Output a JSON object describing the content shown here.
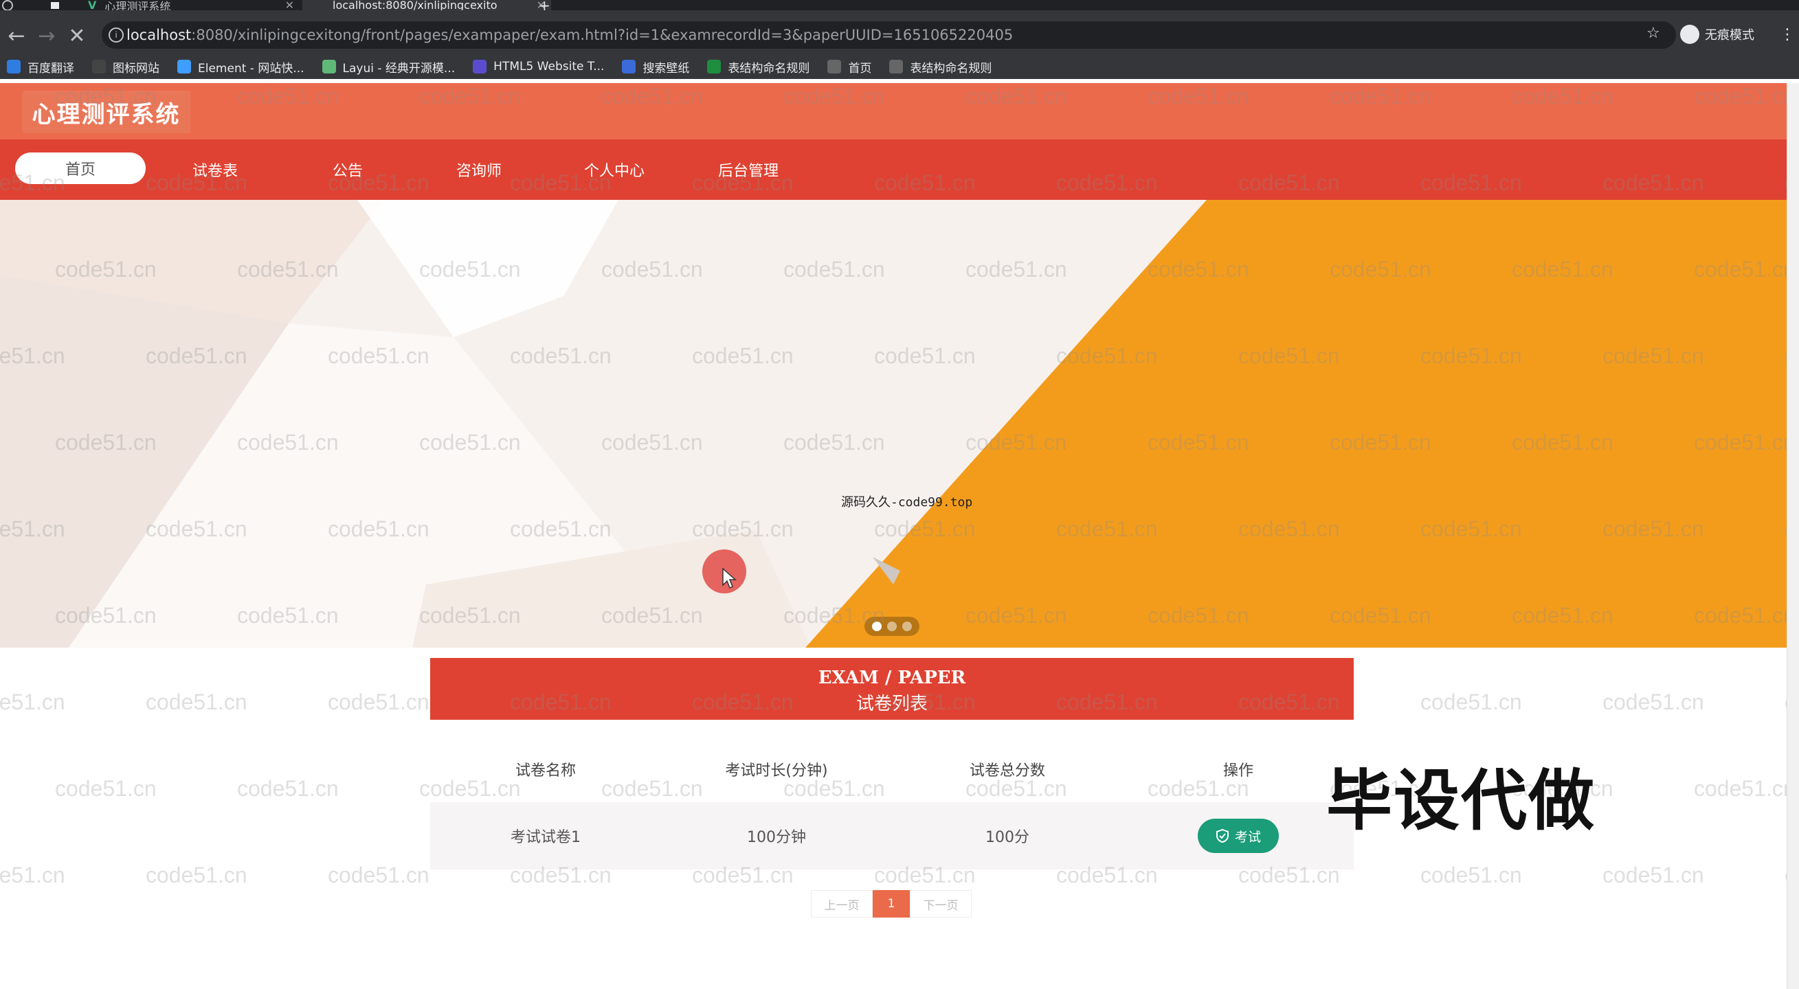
{
  "browser": {
    "tabs": [
      {
        "title": "心理测评系统",
        "active": false
      },
      {
        "title": "localhost:8080/xinlipingcexito",
        "active": true
      }
    ],
    "url_host": "localhost",
    "url_rest": ":8080/xinlipingcexitong/front/pages/exampaper/exam.html?id=1&examrecordId=3&paperUUID=1651065220405",
    "incognito_label": "无痕模式",
    "bookmarks": [
      {
        "label": "百度翻译",
        "icon": "baidu-translate-icon",
        "color": "#2f7de1"
      },
      {
        "label": "图标网站",
        "icon": "flag-icon",
        "color": "#444"
      },
      {
        "label": "Element - 网站快...",
        "icon": "element-logo-icon",
        "color": "#409eff"
      },
      {
        "label": "Layui - 经典开源模...",
        "icon": "layui-logo-icon",
        "color": "#5fb878"
      },
      {
        "label": "HTML5 Website T...",
        "icon": "html5-template-icon",
        "color": "#5b4ccf"
      },
      {
        "label": "搜索壁纸",
        "icon": "u-logo-icon",
        "color": "#3a6bd8"
      },
      {
        "label": "表结构命名规则",
        "icon": "sheet-icon",
        "color": "#1e8e3e"
      },
      {
        "label": "首页",
        "icon": "globe-icon",
        "color": "#666"
      },
      {
        "label": "表结构命名规则",
        "icon": "globe-icon",
        "color": "#666"
      }
    ]
  },
  "site": {
    "logo": "心理测评系统",
    "nav": [
      {
        "label": "首页",
        "active": true
      },
      {
        "label": "试卷表",
        "active": false
      },
      {
        "label": "公告",
        "active": false
      },
      {
        "label": "咨询师",
        "active": false
      },
      {
        "label": "个人中心",
        "active": false
      },
      {
        "label": "后台管理",
        "active": false
      }
    ],
    "banner_caption": "源码久久-code99.top",
    "section": {
      "title_en": "EXAM / PAPER",
      "title_zh": "试卷列表"
    },
    "table": {
      "headers": [
        "试卷名称",
        "考试时长(分钟)",
        "试卷总分数",
        "操作"
      ],
      "rows": [
        {
          "name": "考试试卷1",
          "duration": "100分钟",
          "score": "100分",
          "action": "考试"
        }
      ]
    },
    "pager": {
      "prev": "上一页",
      "current": "1",
      "next": "下一页"
    },
    "overlay_text": "毕设代做",
    "watermark": "code51.cn"
  },
  "colors": {
    "header": "#ec6a4c",
    "navbar": "#df4232",
    "banner_orange": "#f39c1c",
    "exam_button": "#1a9d78",
    "pager_active": "#ea6a4a"
  }
}
